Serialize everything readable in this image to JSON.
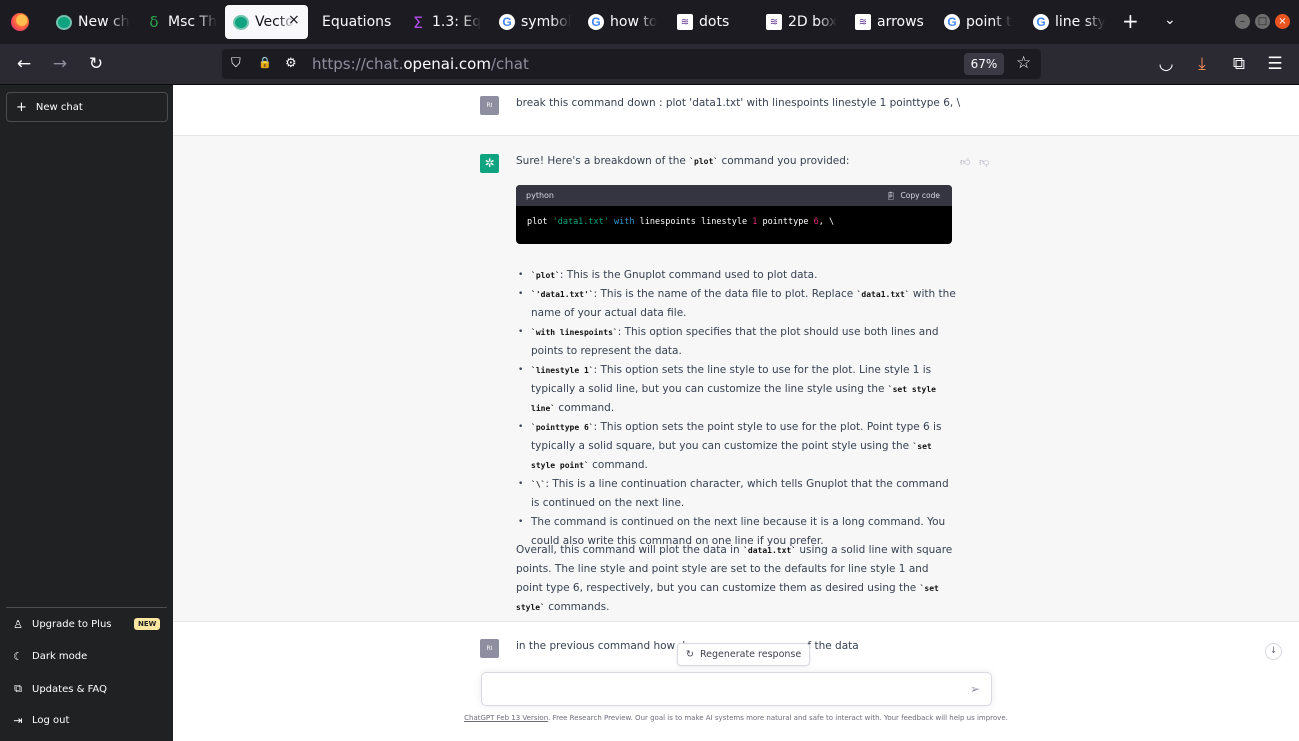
{
  "browser": {
    "tabs": [
      {
        "label": "New ch",
        "icon": "chatgpt-icon"
      },
      {
        "label": "Msc Th",
        "icon": "delta-icon"
      },
      {
        "label": "Vecto",
        "icon": "chatgpt-icon"
      },
      {
        "label": "Equations",
        "icon": ""
      },
      {
        "label": "1.3: Eq",
        "icon": "sigma-icon"
      },
      {
        "label": "symbol",
        "icon": "google-icon"
      },
      {
        "label": "how to",
        "icon": "google-icon"
      },
      {
        "label": "dots",
        "icon": "tex-icon"
      },
      {
        "label": "2D box",
        "icon": "tex-icon"
      },
      {
        "label": "arrows",
        "icon": "tex-icon"
      },
      {
        "label": "point t",
        "icon": "google-icon"
      },
      {
        "label": "line sty",
        "icon": "google-icon"
      }
    ],
    "url_prefix": "https://chat.",
    "url_domain": "openai.com",
    "url_path": "/chat",
    "zoom": "67%",
    "icons": {
      "close": "×",
      "new_tab": "+",
      "back": "←",
      "forward": "→",
      "reload": "↻",
      "shield": "⛉",
      "lock": "🔒",
      "permissions": "⚙",
      "star": "☆",
      "pocket": "◡",
      "download": "⤓",
      "extensions": "⧉",
      "menu": "☰",
      "tablist": "⌄",
      "minimize": "–",
      "maximize": "□",
      "window_close": "×"
    }
  },
  "sidebar": {
    "new_chat": "New chat",
    "upgrade": "Upgrade to Plus",
    "new_badge": "NEW",
    "dark_mode": "Dark mode",
    "updates": "Updates & FAQ",
    "logout": "Log out"
  },
  "chat": {
    "user_initials": "RI",
    "user_message": "break this command down : plot 'data1.txt' with linespoints linestyle 1 pointtype 6, \\",
    "bot_intro_before": "Sure! Here's a breakdown of the ",
    "bot_intro_code": "`plot`",
    "bot_intro_after": " command you provided:",
    "code_lang": "python",
    "copy_label": "Copy code",
    "code": {
      "t1": "plot ",
      "t2": "'data1.txt'",
      "t3": " ",
      "t4": "with",
      "t5": " linespoints linestyle ",
      "t6": "1",
      "t7": " pointtype ",
      "t8": "6",
      "t9": ", \\"
    },
    "bullets": [
      {
        "code": "`plot`",
        "text": ": This is the Gnuplot command used to plot data."
      },
      {
        "code": "`'data1.txt'`",
        "text": ": This is the name of the data file to plot. Replace ",
        "code2": "`data1.txt`",
        "text2": " with the name of your actual data file."
      },
      {
        "code": "`with linespoints`",
        "text": ": This option specifies that the plot should use both lines and points to represent the data."
      },
      {
        "code": "`linestyle 1`",
        "text": ": This option sets the line style to use for the plot. Line style 1 is typically a solid line, but you can customize the line style using the ",
        "code2": "`set style line`",
        "text2": " command."
      },
      {
        "code": "`pointtype 6`",
        "text": ": This option sets the point style to use for the plot. Point type 6 is typically a solid square, but you can customize the point style using the ",
        "code2": "`set style point`",
        "text2": " command."
      },
      {
        "code": "`\\`",
        "text": ": This is a line continuation character, which tells Gnuplot that the command is continued on the next line."
      },
      {
        "code": "",
        "text": "The command is continued on the next line because it is a long command. You could also write this command on one line if you prefer."
      }
    ],
    "summary_1": "Overall, this command will plot the data in ",
    "summary_code1": "`data1.txt`",
    "summary_2": " using a solid line with square points. The line style and point style are set to the defaults for line style 1 and point type 6, respectively, but you can customize them as desired using the ",
    "summary_code2": "`set style`",
    "summary_3": " commands.",
    "user_message_2_start": "in the previous command how do",
    "user_message_2_end": "of the data",
    "regenerate": "Regenerate response",
    "input_placeholder": "",
    "footer_link": "ChatGPT Feb 13 Version",
    "footer_text": ". Free Research Preview. Our goal is to make AI systems more natural and safe to interact with. Your feedback will help us improve."
  }
}
